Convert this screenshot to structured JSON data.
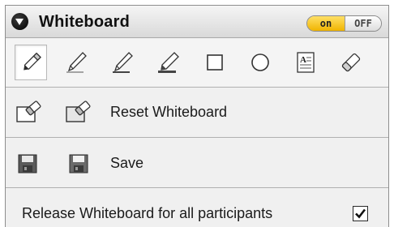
{
  "header": {
    "title": "Whiteboard",
    "toggle_on_label": "on",
    "toggle_off_label": "OFF",
    "toggle_state": "on",
    "accent_color": "#f0b400"
  },
  "toolbar": {
    "tools": [
      {
        "name": "eraser-pointer",
        "icon": "eraser-pencil-icon",
        "selected": true
      },
      {
        "name": "pen-thin",
        "icon": "pen-icon",
        "selected": false
      },
      {
        "name": "pen-medium",
        "icon": "pen-icon",
        "selected": false
      },
      {
        "name": "marker",
        "icon": "marker-icon",
        "selected": false
      },
      {
        "name": "rectangle",
        "icon": "square-icon",
        "selected": false
      },
      {
        "name": "ellipse",
        "icon": "circle-icon",
        "selected": false
      },
      {
        "name": "text",
        "icon": "text-icon",
        "selected": false
      },
      {
        "name": "eraser",
        "icon": "eraser-icon",
        "selected": false
      }
    ]
  },
  "reset": {
    "label": "Reset Whiteboard",
    "icons": [
      "board-eraser-icon",
      "board-eraser-icon"
    ]
  },
  "save": {
    "label": "Save",
    "icons": [
      "floppy-disk-icon",
      "floppy-disk-icon"
    ]
  },
  "release": {
    "label": "Release Whiteboard for all participants",
    "checked": true
  }
}
